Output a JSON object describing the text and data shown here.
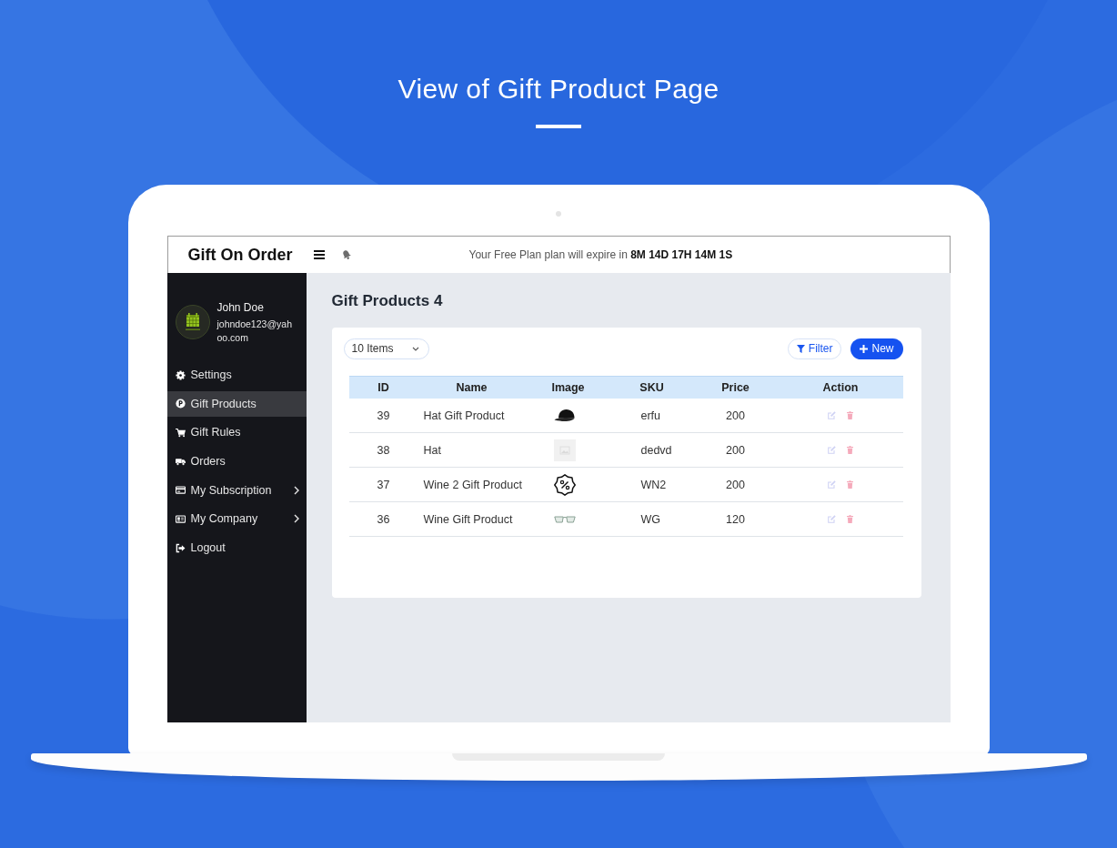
{
  "banner": {
    "title": "View of Gift Product Page"
  },
  "app": {
    "brand": "Gift On Order",
    "plan_notice": "Your Free Plan plan will expire in **8M 14D 17H 14M 1S**"
  },
  "user": {
    "name": "John Doe",
    "email": "johndoe123@yahoo.com"
  },
  "sidebar": {
    "items": [
      {
        "label": "Settings",
        "selected": false,
        "submenu": false
      },
      {
        "label": "Gift Products",
        "selected": true,
        "submenu": false
      },
      {
        "label": "Gift Rules",
        "selected": false,
        "submenu": false
      },
      {
        "label": "Orders",
        "selected": false,
        "submenu": false
      },
      {
        "label": "My Subscription",
        "selected": false,
        "submenu": true
      },
      {
        "label": "My Company",
        "selected": false,
        "submenu": true
      },
      {
        "label": "Logout",
        "selected": false,
        "submenu": false
      }
    ]
  },
  "page": {
    "title": "Gift Products 4"
  },
  "toolbar": {
    "page_size": "10 Items",
    "buttons": [
      {
        "label": "Filter",
        "kind": "outline"
      },
      {
        "label": "New",
        "kind": "primary"
      }
    ]
  },
  "table": {
    "columns": [
      "ID",
      "Name",
      "Image",
      "SKU",
      "Price",
      "Action"
    ],
    "rows": [
      {
        "id": "39",
        "name": "Hat Gift Product",
        "sku": "erfu",
        "price": "200"
      },
      {
        "id": "38",
        "name": "Hat",
        "sku": "dedvd",
        "price": "200"
      },
      {
        "id": "37",
        "name": "Wine 2 Gift Product",
        "sku": "WN2",
        "price": "200"
      },
      {
        "id": "36",
        "name": "Wine Gift Product",
        "sku": "WG",
        "price": "120"
      }
    ]
  }
}
